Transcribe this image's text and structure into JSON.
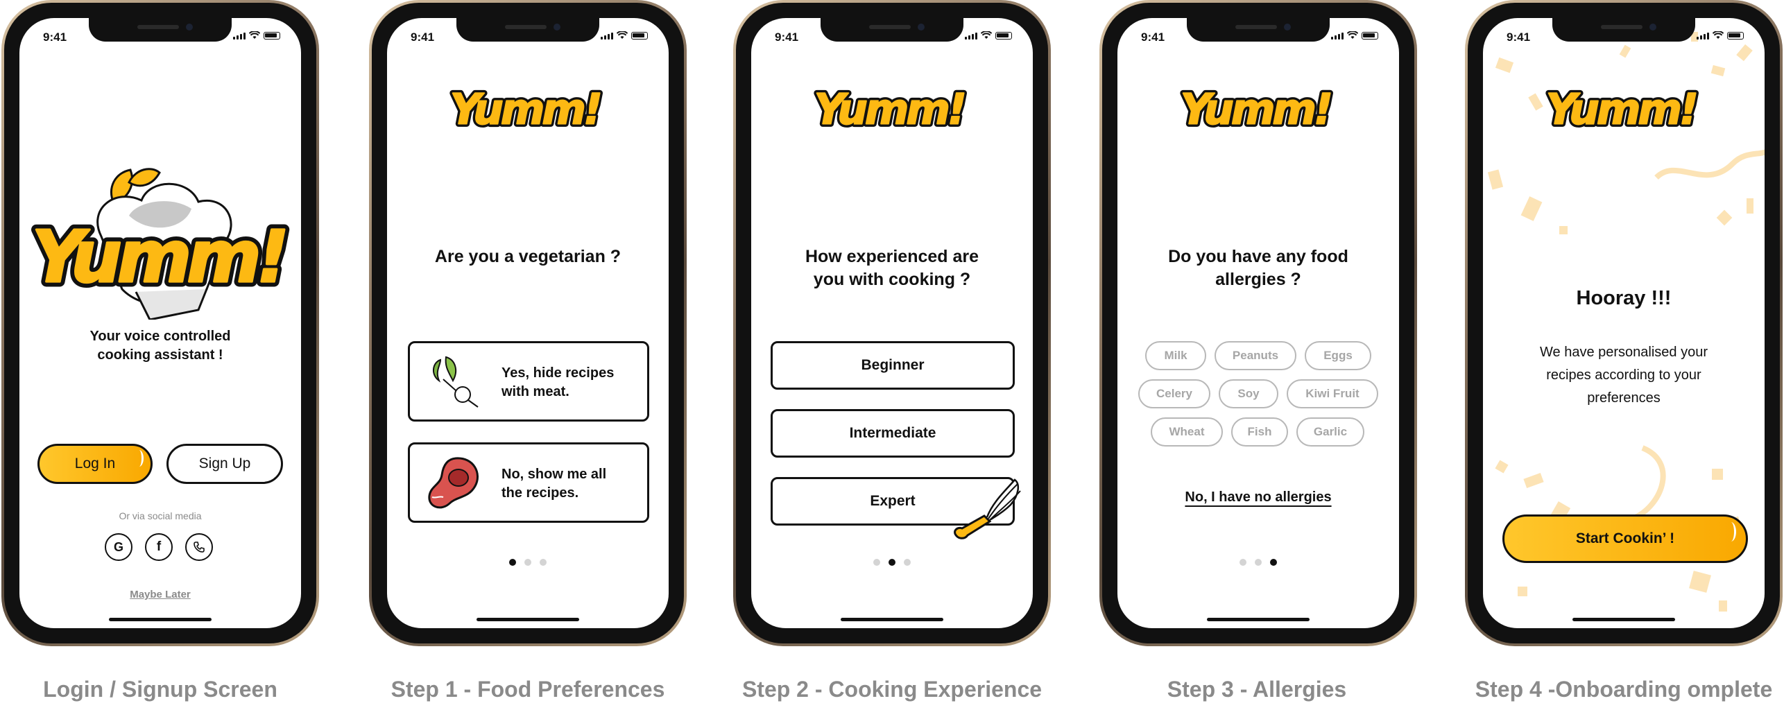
{
  "status": {
    "time": "9:41"
  },
  "colors": {
    "brand_yellow": "#FDB913",
    "text": "#111111",
    "caption": "#8a8a8a",
    "chip_border": "#b8b8b8",
    "confetti": "#FCE3B5"
  },
  "captions": [
    "Login / Signup Screen",
    "Step 1 - Food Preferences",
    "Step 2 - Cooking Experience",
    "Step 3 - Allergies",
    "Step 4 -Onboarding omplete"
  ],
  "login": {
    "tagline_line1": "Your voice controlled",
    "tagline_line2": "cooking assistant !",
    "login_label": "Log In",
    "signup_label": "Sign Up",
    "social_label": "Or via social media",
    "social_icons": [
      "google-icon",
      "facebook-icon",
      "phone-icon"
    ],
    "maybe_later": "Maybe Later"
  },
  "step1": {
    "question": "Are you a vegetarian ?",
    "options": [
      {
        "line1": "Yes, hide recipes",
        "line2": "with meat.",
        "icon": "radish-icon"
      },
      {
        "line1": "No, show me all",
        "line2": "the recipes.",
        "icon": "steak-icon"
      }
    ],
    "active_dot": 1
  },
  "step2": {
    "question_line1": "How experienced are",
    "question_line2": "you with cooking ?",
    "options": [
      "Beginner",
      "Intermediate",
      "Expert"
    ],
    "active_dot": 2
  },
  "step3": {
    "question_line1": "Do you have any food",
    "question_line2": "allergies ?",
    "allergies": [
      "Milk",
      "Peanuts",
      "Eggs",
      "Celery",
      "Soy",
      "Kiwi Fruit",
      "Wheat",
      "Fish",
      "Garlic"
    ],
    "no_allergies_link": "No, I have no allergies",
    "active_dot": 3
  },
  "step4": {
    "title": "Hooray !!!",
    "message_line1": "We have personalised your",
    "message_line2": "recipes according to your",
    "message_line3": "preferences",
    "cta_label": "Start Cookin’ !"
  }
}
